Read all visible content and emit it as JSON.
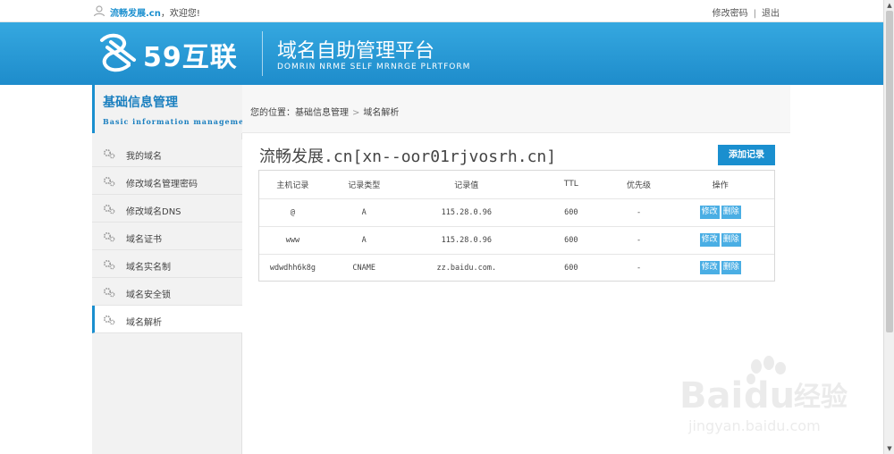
{
  "topbar": {
    "username": "流畅发展.cn",
    "greeting": "，欢迎您!",
    "change_password": "修改密码",
    "separator": "|",
    "logout": "退出"
  },
  "header": {
    "logo_text": "59互联",
    "platform_title": "域名自助管理平台",
    "platform_subtitle": "DOMRIN NRME SELF MRNRGE PLRTFORM"
  },
  "sidebar": {
    "title": "基础信息管理",
    "subtitle": "Basic information management",
    "items": [
      {
        "label": "我的域名"
      },
      {
        "label": "修改域名管理密码"
      },
      {
        "label": "修改域名DNS"
      },
      {
        "label": "域名证书"
      },
      {
        "label": "域名实名制"
      },
      {
        "label": "域名安全锁"
      },
      {
        "label": "域名解析"
      }
    ]
  },
  "breadcrumb": {
    "prefix": "您的位置：",
    "level1": "基础信息管理",
    "arrow": ">",
    "level2": "域名解析"
  },
  "main": {
    "domain_title": "流畅发展.cn[xn--oor01rjvosrh.cn]",
    "add_record_label": "添加记录",
    "columns": [
      "主机记录",
      "记录类型",
      "记录值",
      "TTL",
      "优先级",
      "操作"
    ],
    "rows": [
      {
        "host": "@",
        "type": "A",
        "value": "115.28.0.96",
        "ttl": "600",
        "priority": "-"
      },
      {
        "host": "www",
        "type": "A",
        "value": "115.28.0.96",
        "ttl": "600",
        "priority": "-"
      },
      {
        "host": "wdwdhh6k8g",
        "type": "CNAME",
        "value": "zz.baidu.com.",
        "ttl": "600",
        "priority": "-"
      }
    ],
    "edit_label": "修改",
    "delete_label": "删除"
  },
  "watermark": {
    "brand": "Bai du 经验",
    "url": "jingyan.baidu.com"
  },
  "colors": {
    "accent": "#1a8fcf",
    "header_top": "#35a8e0",
    "header_bottom": "#1e8ccb",
    "op_button": "#4aaee4"
  }
}
